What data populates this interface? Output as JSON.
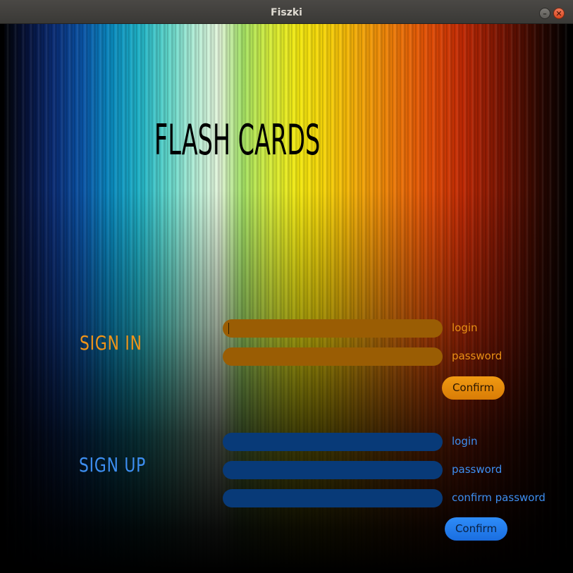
{
  "window": {
    "title": "Fiszki",
    "minimize_glyph": "–",
    "close_glyph": "✕"
  },
  "app": {
    "title": "FLASH CARDS"
  },
  "sign_in": {
    "title": "SIGN IN",
    "login_label": "login",
    "password_label": "password",
    "login_value": "",
    "password_value": "",
    "confirm_label": "Confirm",
    "accent_color": "#f09418"
  },
  "sign_up": {
    "title": "SIGN UP",
    "login_label": "login",
    "password_label": "password",
    "confirm_password_label": "confirm password",
    "login_value": "",
    "password_value": "",
    "confirm_password_value": "",
    "confirm_label": "Confirm",
    "accent_color": "#3d8ef0"
  }
}
